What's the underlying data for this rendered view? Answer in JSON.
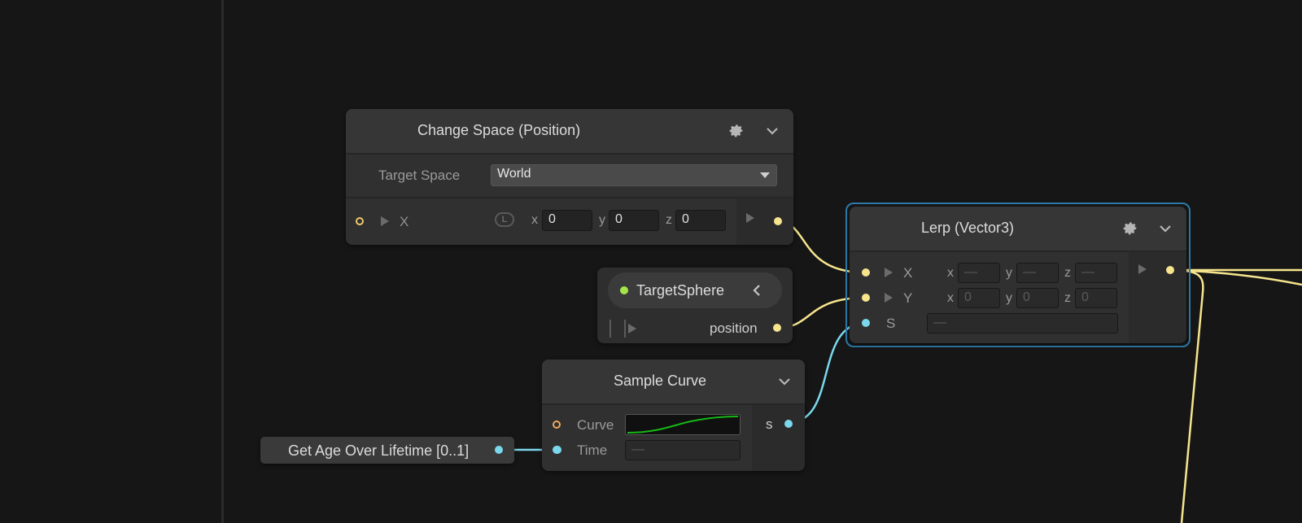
{
  "nodes": {
    "change_space": {
      "title": "Change Space (Position)",
      "target_space_label": "Target Space",
      "target_space_value": "World",
      "input_label": "X",
      "space_badge": "L",
      "x_label": "x",
      "x_value": "0",
      "y_label": "y",
      "y_value": "0",
      "z_label": "z",
      "z_value": "0"
    },
    "target_sphere": {
      "title": "TargetSphere",
      "output_label": "position"
    },
    "sample_curve": {
      "title": "Sample Curve",
      "curve_label": "Curve",
      "time_label": "Time",
      "time_value": "—",
      "output_label": "s"
    },
    "get_age": {
      "title": "Get Age Over Lifetime [0..1]"
    },
    "lerp": {
      "title": "Lerp (Vector3)",
      "x_input": "X",
      "y_input": "Y",
      "s_input": "S",
      "x_row": {
        "x_label": "x",
        "x_value": "—",
        "y_label": "y",
        "y_value": "—",
        "z_label": "z",
        "z_value": "—"
      },
      "y_row": {
        "x_label": "x",
        "x_value": "0",
        "y_label": "y",
        "y_value": "0",
        "z_label": "z",
        "z_value": "0"
      },
      "s_value": "—"
    }
  },
  "colors": {
    "background": "#161616",
    "vector_wire": "#f6e58d",
    "float_wire": "#7bd8ec",
    "selection_outline": "#2e7bab",
    "curve": "#16b816"
  }
}
